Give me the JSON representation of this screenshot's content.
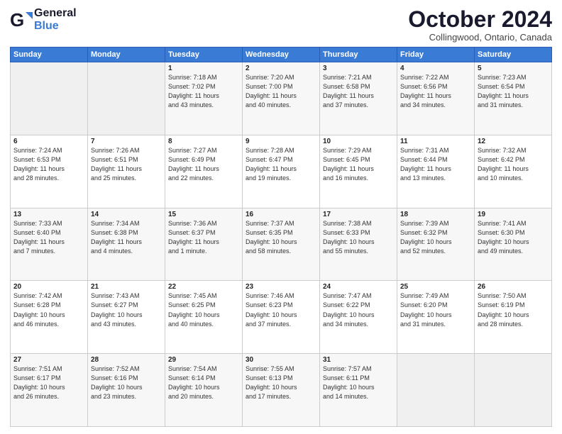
{
  "logo": {
    "general": "General",
    "blue": "Blue"
  },
  "header": {
    "title": "October 2024",
    "subtitle": "Collingwood, Ontario, Canada"
  },
  "days_of_week": [
    "Sunday",
    "Monday",
    "Tuesday",
    "Wednesday",
    "Thursday",
    "Friday",
    "Saturday"
  ],
  "weeks": [
    [
      {
        "day": "",
        "info": ""
      },
      {
        "day": "",
        "info": ""
      },
      {
        "day": "1",
        "info": "Sunrise: 7:18 AM\nSunset: 7:02 PM\nDaylight: 11 hours\nand 43 minutes."
      },
      {
        "day": "2",
        "info": "Sunrise: 7:20 AM\nSunset: 7:00 PM\nDaylight: 11 hours\nand 40 minutes."
      },
      {
        "day": "3",
        "info": "Sunrise: 7:21 AM\nSunset: 6:58 PM\nDaylight: 11 hours\nand 37 minutes."
      },
      {
        "day": "4",
        "info": "Sunrise: 7:22 AM\nSunset: 6:56 PM\nDaylight: 11 hours\nand 34 minutes."
      },
      {
        "day": "5",
        "info": "Sunrise: 7:23 AM\nSunset: 6:54 PM\nDaylight: 11 hours\nand 31 minutes."
      }
    ],
    [
      {
        "day": "6",
        "info": "Sunrise: 7:24 AM\nSunset: 6:53 PM\nDaylight: 11 hours\nand 28 minutes."
      },
      {
        "day": "7",
        "info": "Sunrise: 7:26 AM\nSunset: 6:51 PM\nDaylight: 11 hours\nand 25 minutes."
      },
      {
        "day": "8",
        "info": "Sunrise: 7:27 AM\nSunset: 6:49 PM\nDaylight: 11 hours\nand 22 minutes."
      },
      {
        "day": "9",
        "info": "Sunrise: 7:28 AM\nSunset: 6:47 PM\nDaylight: 11 hours\nand 19 minutes."
      },
      {
        "day": "10",
        "info": "Sunrise: 7:29 AM\nSunset: 6:45 PM\nDaylight: 11 hours\nand 16 minutes."
      },
      {
        "day": "11",
        "info": "Sunrise: 7:31 AM\nSunset: 6:44 PM\nDaylight: 11 hours\nand 13 minutes."
      },
      {
        "day": "12",
        "info": "Sunrise: 7:32 AM\nSunset: 6:42 PM\nDaylight: 11 hours\nand 10 minutes."
      }
    ],
    [
      {
        "day": "13",
        "info": "Sunrise: 7:33 AM\nSunset: 6:40 PM\nDaylight: 11 hours\nand 7 minutes."
      },
      {
        "day": "14",
        "info": "Sunrise: 7:34 AM\nSunset: 6:38 PM\nDaylight: 11 hours\nand 4 minutes."
      },
      {
        "day": "15",
        "info": "Sunrise: 7:36 AM\nSunset: 6:37 PM\nDaylight: 11 hours\nand 1 minute."
      },
      {
        "day": "16",
        "info": "Sunrise: 7:37 AM\nSunset: 6:35 PM\nDaylight: 10 hours\nand 58 minutes."
      },
      {
        "day": "17",
        "info": "Sunrise: 7:38 AM\nSunset: 6:33 PM\nDaylight: 10 hours\nand 55 minutes."
      },
      {
        "day": "18",
        "info": "Sunrise: 7:39 AM\nSunset: 6:32 PM\nDaylight: 10 hours\nand 52 minutes."
      },
      {
        "day": "19",
        "info": "Sunrise: 7:41 AM\nSunset: 6:30 PM\nDaylight: 10 hours\nand 49 minutes."
      }
    ],
    [
      {
        "day": "20",
        "info": "Sunrise: 7:42 AM\nSunset: 6:28 PM\nDaylight: 10 hours\nand 46 minutes."
      },
      {
        "day": "21",
        "info": "Sunrise: 7:43 AM\nSunset: 6:27 PM\nDaylight: 10 hours\nand 43 minutes."
      },
      {
        "day": "22",
        "info": "Sunrise: 7:45 AM\nSunset: 6:25 PM\nDaylight: 10 hours\nand 40 minutes."
      },
      {
        "day": "23",
        "info": "Sunrise: 7:46 AM\nSunset: 6:23 PM\nDaylight: 10 hours\nand 37 minutes."
      },
      {
        "day": "24",
        "info": "Sunrise: 7:47 AM\nSunset: 6:22 PM\nDaylight: 10 hours\nand 34 minutes."
      },
      {
        "day": "25",
        "info": "Sunrise: 7:49 AM\nSunset: 6:20 PM\nDaylight: 10 hours\nand 31 minutes."
      },
      {
        "day": "26",
        "info": "Sunrise: 7:50 AM\nSunset: 6:19 PM\nDaylight: 10 hours\nand 28 minutes."
      }
    ],
    [
      {
        "day": "27",
        "info": "Sunrise: 7:51 AM\nSunset: 6:17 PM\nDaylight: 10 hours\nand 26 minutes."
      },
      {
        "day": "28",
        "info": "Sunrise: 7:52 AM\nSunset: 6:16 PM\nDaylight: 10 hours\nand 23 minutes."
      },
      {
        "day": "29",
        "info": "Sunrise: 7:54 AM\nSunset: 6:14 PM\nDaylight: 10 hours\nand 20 minutes."
      },
      {
        "day": "30",
        "info": "Sunrise: 7:55 AM\nSunset: 6:13 PM\nDaylight: 10 hours\nand 17 minutes."
      },
      {
        "day": "31",
        "info": "Sunrise: 7:57 AM\nSunset: 6:11 PM\nDaylight: 10 hours\nand 14 minutes."
      },
      {
        "day": "",
        "info": ""
      },
      {
        "day": "",
        "info": ""
      }
    ]
  ]
}
